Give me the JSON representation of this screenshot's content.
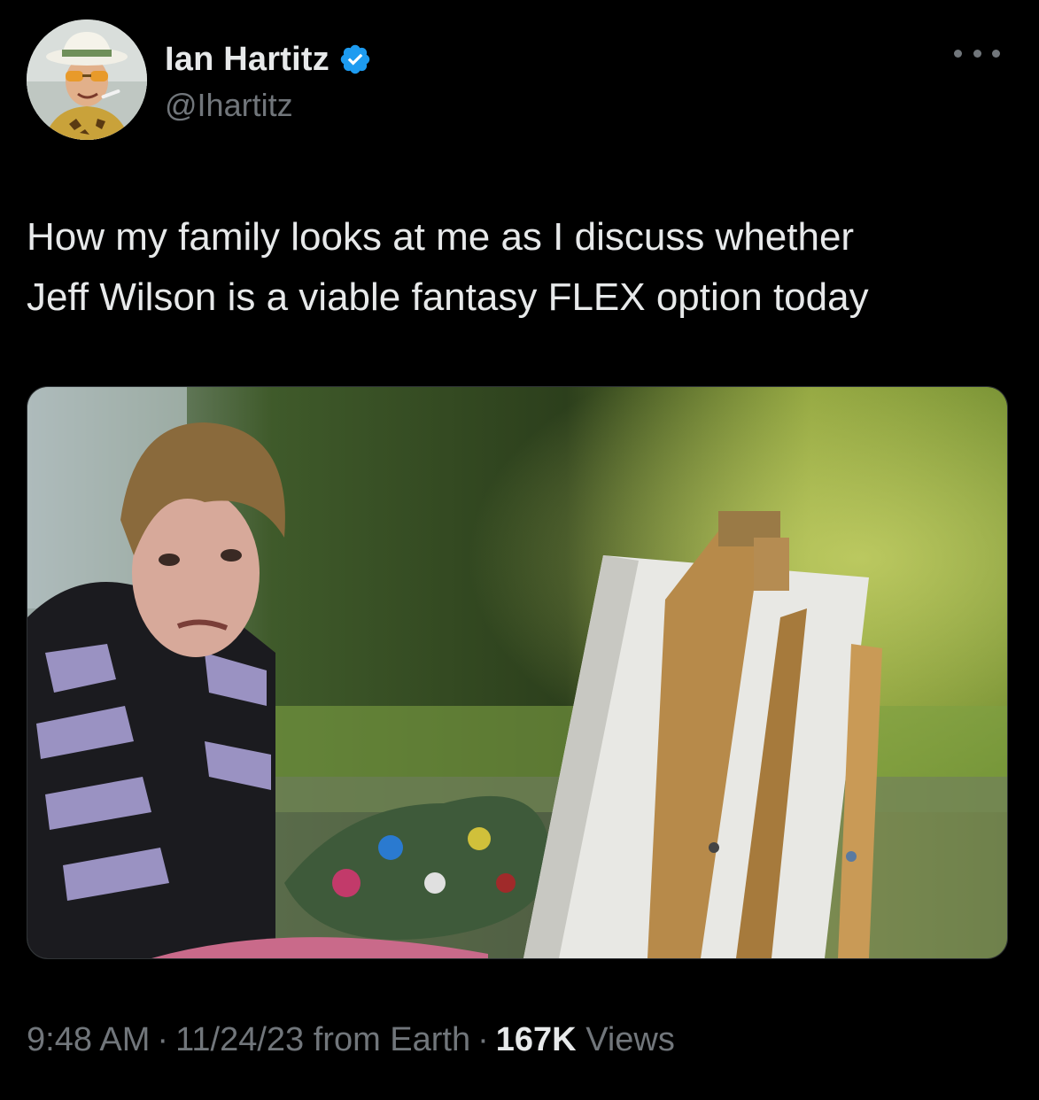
{
  "author": {
    "display_name": "Ian Hartitz",
    "handle": "@Ihartitz",
    "verified": true,
    "verified_badge_color": "#1d9bf0",
    "avatar_icon": "profile-photo-icon"
  },
  "tweet": {
    "text_lines": [
      "How my family looks at me as I discuss whether",
      "Jeff Wilson is a viable fantasy FLEX option today"
    ],
    "media_icon": "attached-photo-icon"
  },
  "meta": {
    "time": "9:48 AM",
    "separator": "·",
    "date_source": "11/24/23 from Earth",
    "views_count": "167K",
    "views_label": "Views"
  },
  "colors": {
    "background": "#000000",
    "primary_text": "#e7e9ea",
    "secondary_text": "#71767b"
  }
}
